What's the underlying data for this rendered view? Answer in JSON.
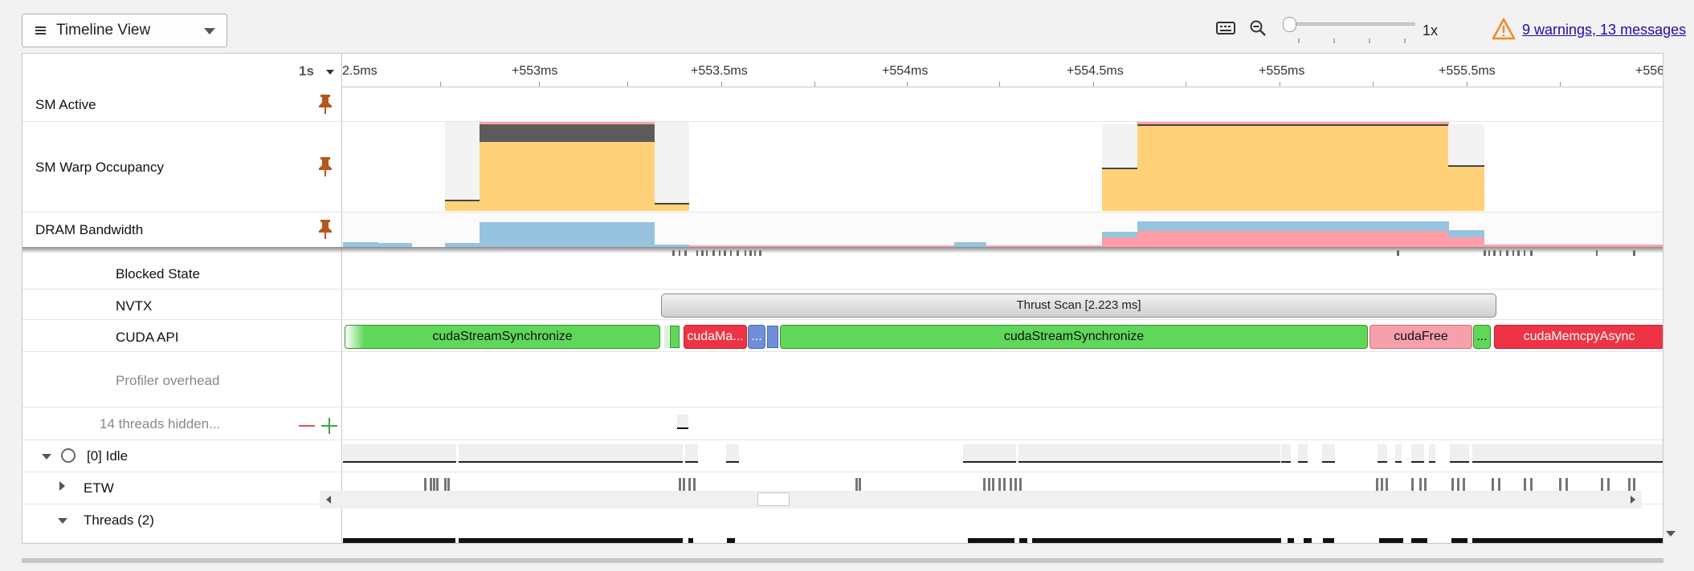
{
  "toolbar": {
    "view_label": "Timeline View",
    "zoom_level": "1x",
    "warnings_link": "9 warnings, 13 messages",
    "icons": [
      "menu-icon",
      "chevron-down-icon",
      "keyboard-icon",
      "zoom-out-icon",
      "warning-icon"
    ]
  },
  "timeline": {
    "scale_label": "1s",
    "ruler_labels": [
      "2.5ms",
      "+553ms",
      "+553.5ms",
      "+554ms",
      "+554.5ms",
      "+555ms",
      "+555.5ms",
      "+556"
    ]
  },
  "rows": {
    "sm_active": "SM Active",
    "sm_warp": "SM Warp Occupancy",
    "dram": "DRAM Bandwidth",
    "blocked": "Blocked State",
    "nvtx": "NVTX",
    "cuda_api": "CUDA API",
    "profiler": "Profiler overhead",
    "hidden": "14 threads hidden...",
    "idle": "[0] Idle",
    "etw": "ETW",
    "threads": "Threads (2)"
  },
  "nvtx_range": "Thrust Scan [2.223 ms]",
  "cuda_calls": {
    "c0": "cudaStreamSynchronize",
    "c1": "cudaMa...",
    "c2": "...",
    "c3": "cudaStreamSynchronize",
    "c4": "cudaFree",
    "c5": "...",
    "c6": "cudaMemcpyAsync"
  },
  "colors": {
    "sm_active": "#ffa3a8",
    "warp_occupancy": "#ffd27a",
    "warp_dark": "#5c5c5c",
    "dram_read": "#96c3de",
    "dram_write": "#ff9ea7",
    "api_green": "#5fd85a",
    "api_red": "#ee3345"
  }
}
